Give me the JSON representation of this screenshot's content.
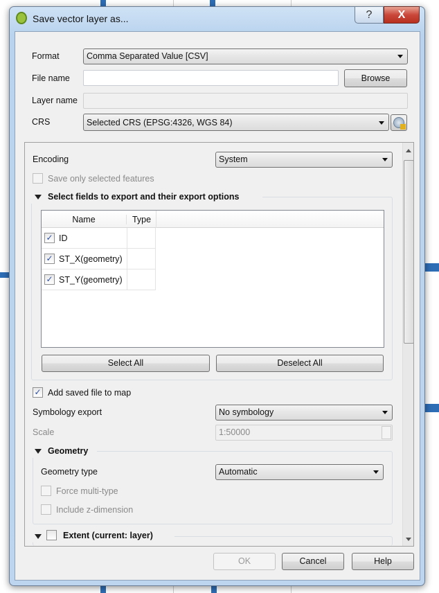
{
  "window": {
    "title": "Save vector layer as...",
    "help_btn": "?",
    "close_btn": "X"
  },
  "form": {
    "format_label": "Format",
    "format_value": "Comma Separated Value [CSV]",
    "filename_label": "File name",
    "filename_value": "",
    "browse": "Browse",
    "layername_label": "Layer name",
    "layername_value": "",
    "crs_label": "CRS",
    "crs_value": "Selected CRS (EPSG:4326, WGS 84)"
  },
  "options": {
    "encoding_label": "Encoding",
    "encoding_value": "System",
    "save_selected": "Save only selected features",
    "save_selected_checked": false,
    "fields_group": "Select fields to export and their export options",
    "columns": [
      "Name",
      "Type"
    ],
    "fields": [
      {
        "name": "ID",
        "checked": true,
        "type": ""
      },
      {
        "name": "ST_X(geometry)",
        "checked": true,
        "type": ""
      },
      {
        "name": "ST_Y(geometry)",
        "checked": true,
        "type": ""
      }
    ],
    "select_all": "Select All",
    "deselect_all": "Deselect All",
    "add_to_map": "Add saved file to map",
    "add_to_map_checked": true,
    "symbology_label": "Symbology export",
    "symbology_value": "No symbology",
    "scale_label": "Scale",
    "scale_value": "1:50000",
    "geometry_group": "Geometry",
    "geometry_type_label": "Geometry type",
    "geometry_type_value": "Automatic",
    "force_multi": "Force multi-type",
    "include_z": "Include z-dimension",
    "extent_group": "Extent (current: layer)"
  },
  "buttons": {
    "ok": "OK",
    "cancel": "Cancel",
    "help": "Help"
  }
}
